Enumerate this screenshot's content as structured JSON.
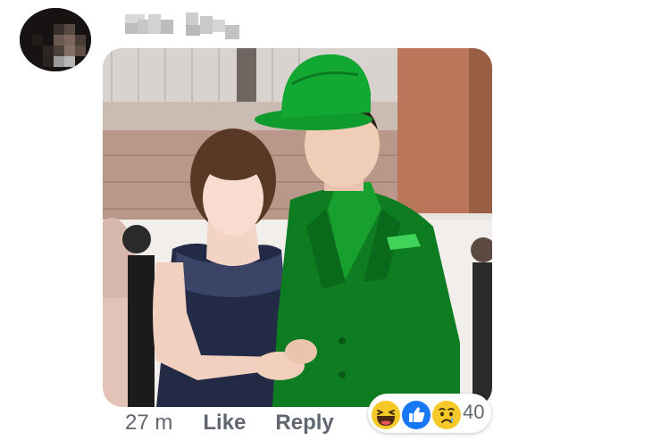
{
  "comment": {
    "author": {
      "name": "",
      "avatar_icon": "blurred-avatar"
    },
    "photo": {
      "icon": "photo-attachment"
    },
    "timestamp": "27 m",
    "actions": {
      "like_label": "Like",
      "reply_label": "Reply"
    },
    "reactions": {
      "icons": [
        "haha-reaction-icon",
        "like-reaction-icon",
        "sad-reaction-icon"
      ],
      "count": "40"
    }
  },
  "colors": {
    "meta_text": "#606770",
    "like_blue": "#1877f2",
    "reaction_yellow": "#f7c928",
    "hat_green": "#12a832",
    "suit_green": "#0f8a23"
  }
}
